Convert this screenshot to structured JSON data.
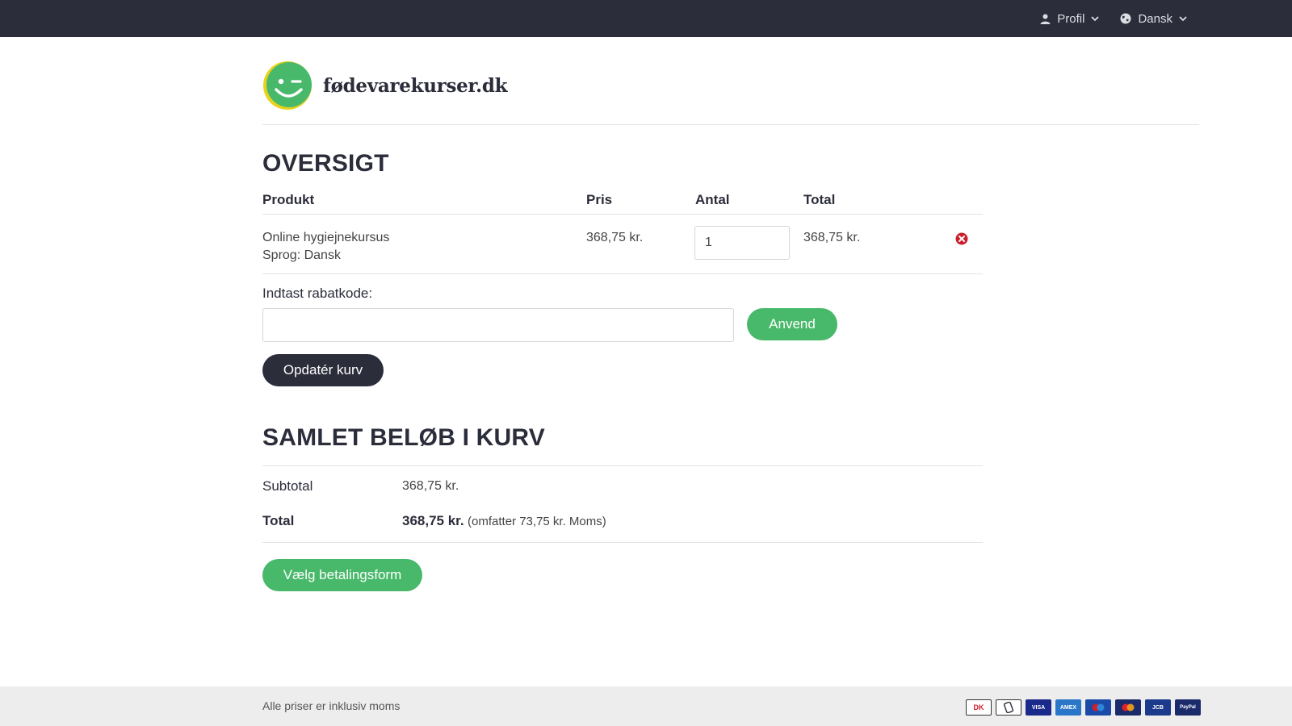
{
  "topbar": {
    "profile_label": "Profil",
    "language_label": "Dansk"
  },
  "brand": {
    "name": "fødevarekurser.dk",
    "colors": {
      "green": "#48b96a",
      "yellow": "#e8d21d",
      "dark": "#2b2d3a"
    }
  },
  "cart": {
    "title": "OVERSIGT",
    "columns": {
      "product": "Produkt",
      "price": "Pris",
      "quantity": "Antal",
      "total": "Total"
    },
    "items": [
      {
        "name": "Online hygiejnekursus",
        "language": "Sprog: Dansk",
        "price": "368,75 kr.",
        "quantity": "1",
        "total": "368,75 kr."
      }
    ],
    "coupon_label": "Indtast rabatkode:",
    "coupon_value": "",
    "apply_label": "Anvend",
    "update_label": "Opdatér kurv"
  },
  "totals": {
    "title": "SAMLET BELØB I KURV",
    "subtotal_label": "Subtotal",
    "subtotal_value": "368,75 kr.",
    "total_label": "Total",
    "total_value": "368,75 kr.",
    "tax_note": "(omfatter 73,75 kr. Moms)",
    "checkout_label": "Vælg betalingsform"
  },
  "footer": {
    "note": "Alle priser er inklusiv moms",
    "payment_icons": [
      "dankort-icon",
      "mobilepay-icon",
      "visa-icon",
      "amex-icon",
      "maestro-icon",
      "mastercard-icon",
      "jcb-icon",
      "paypal-icon"
    ],
    "card_texts": {
      "dankort": "DK",
      "visa": "VISA",
      "amex": "AMEX",
      "jcb": "JCB",
      "paypal": "PayPal"
    }
  }
}
